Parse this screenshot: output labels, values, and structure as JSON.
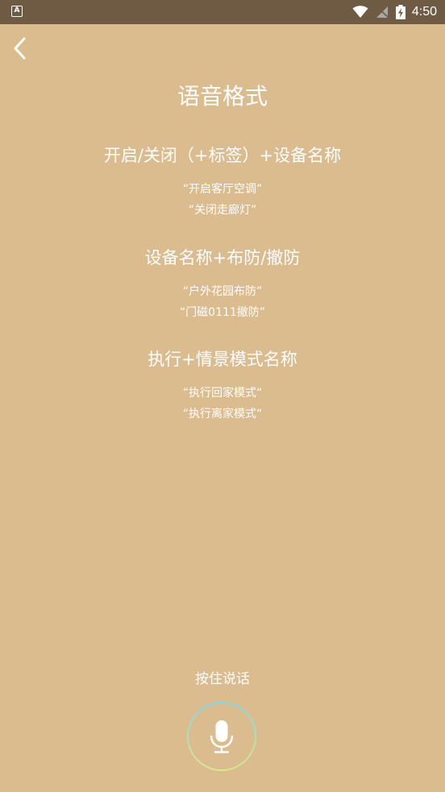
{
  "status_bar": {
    "app_icon_letter": "A",
    "time": "4:50"
  },
  "title": "语音格式",
  "sections": [
    {
      "heading": "开启/关闭（+标签）+设备名称",
      "examples": [
        "“开启客厅空调”",
        "“关闭走廊灯”"
      ]
    },
    {
      "heading": "设备名称+布防/撤防",
      "examples": [
        "“户外花园布防”",
        "“门磁0111撤防”"
      ]
    },
    {
      "heading": "执行+情景模式名称",
      "examples": [
        "“执行回家模式“",
        "“执行离家模式“"
      ]
    }
  ],
  "hold_to_talk": "按住说话",
  "colors": {
    "background": "#DBBC8F",
    "status_bar": "#6F5B44",
    "text": "#FFFFFF",
    "mic_ring_start": "#7FD8E8",
    "mic_ring_end": "#D8E88A"
  },
  "icons": {
    "back": "chevron-left-icon",
    "mic": "microphone-icon",
    "wifi": "wifi-icon",
    "signal": "no-sim-signal-icon",
    "battery": "battery-charging-icon"
  }
}
